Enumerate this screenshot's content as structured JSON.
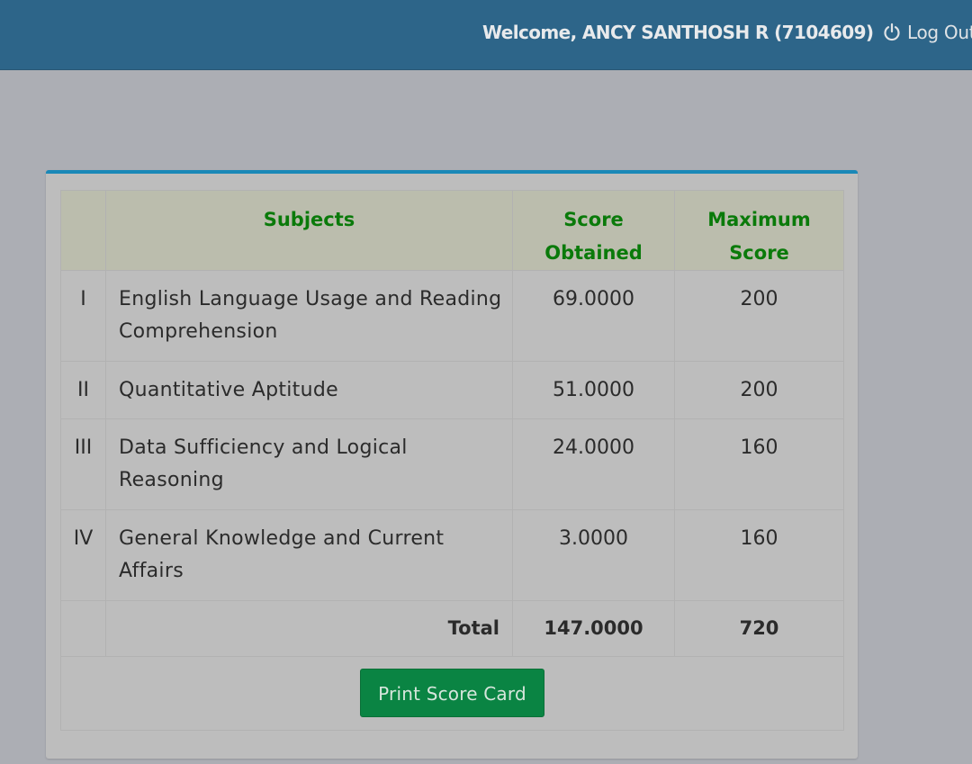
{
  "header": {
    "welcome_text": "Welcome, ANCY SANTHOSH R (7104609)",
    "logout_label": "Log Out",
    "logout_icon": "power-icon"
  },
  "table": {
    "headers": {
      "index": "",
      "subjects": "Subjects",
      "score_obtained_line1": "Score",
      "score_obtained_line2": "Obtained",
      "max_score_line1": "Maximum",
      "max_score_line2": "Score"
    },
    "rows": [
      {
        "num": "I",
        "subject": "English Language Usage and Reading Comprehension",
        "score": "69.0000",
        "max": "200"
      },
      {
        "num": "II",
        "subject": "Quantitative Aptitude",
        "score": "51.0000",
        "max": "200"
      },
      {
        "num": "III",
        "subject": "Data Sufficiency and Logical Reasoning",
        "score": "24.0000",
        "max": "160"
      },
      {
        "num": "IV",
        "subject": "General Knowledge and Current Affairs",
        "score": "3.0000",
        "max": "160"
      }
    ],
    "total": {
      "label": "Total",
      "score": "147.0000",
      "max": "720"
    }
  },
  "actions": {
    "print_label": "Print Score Card"
  },
  "colors": {
    "header_bar": "#2d6589",
    "card_accent": "#1a88b7",
    "table_header_text": "#0a7a0a",
    "print_button": "#0a8443"
  }
}
